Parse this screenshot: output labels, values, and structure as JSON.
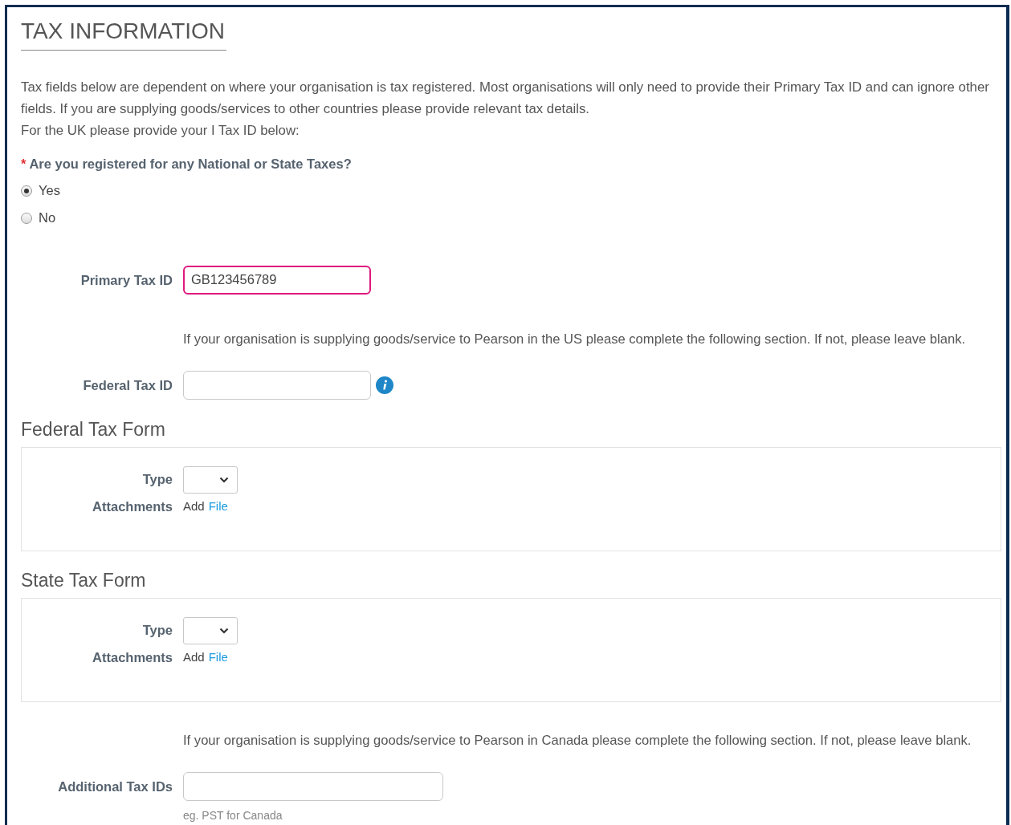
{
  "title": "TAX INFORMATION",
  "intro": [
    "Tax fields below are dependent on where your organisation is tax registered. Most organisations will only need to provide their Primary Tax ID and can ignore other fields. If you are supplying goods/services to other countries please provide relevant tax details.",
    "For the UK please provide your I Tax ID below:"
  ],
  "question": {
    "label": "Are you registered for any National or State Taxes?",
    "required_mark": "*",
    "options": [
      {
        "label": "Yes",
        "selected": true
      },
      {
        "label": "No",
        "selected": false
      }
    ]
  },
  "items": [
    {
      "kind": "field",
      "label": "Primary Tax ID",
      "value": "GB123456789",
      "focused": true
    },
    {
      "kind": "note",
      "text": "If your organisation is supplying goods/service to Pearson in the US please complete the following section. If not, please leave blank."
    },
    {
      "kind": "field",
      "label": "Federal Tax ID",
      "focused": false,
      "info": true
    },
    {
      "kind": "form",
      "title": "Federal Tax Form",
      "type_label": "Type",
      "attachments_label": "Attachments",
      "add": "Add",
      "file_link": "File"
    },
    {
      "kind": "form",
      "title": "State Tax Form",
      "type_label": "Type",
      "attachments_label": "Attachments",
      "add": "Add",
      "file_link": "File"
    },
    {
      "kind": "note",
      "text": "If your organisation is supplying goods/service to Pearson in Canada please complete the following section. If not, please leave blank."
    },
    {
      "kind": "field",
      "label": "Additional Tax IDs",
      "focused": false,
      "hint": "eg. PST for Canada"
    }
  ]
}
